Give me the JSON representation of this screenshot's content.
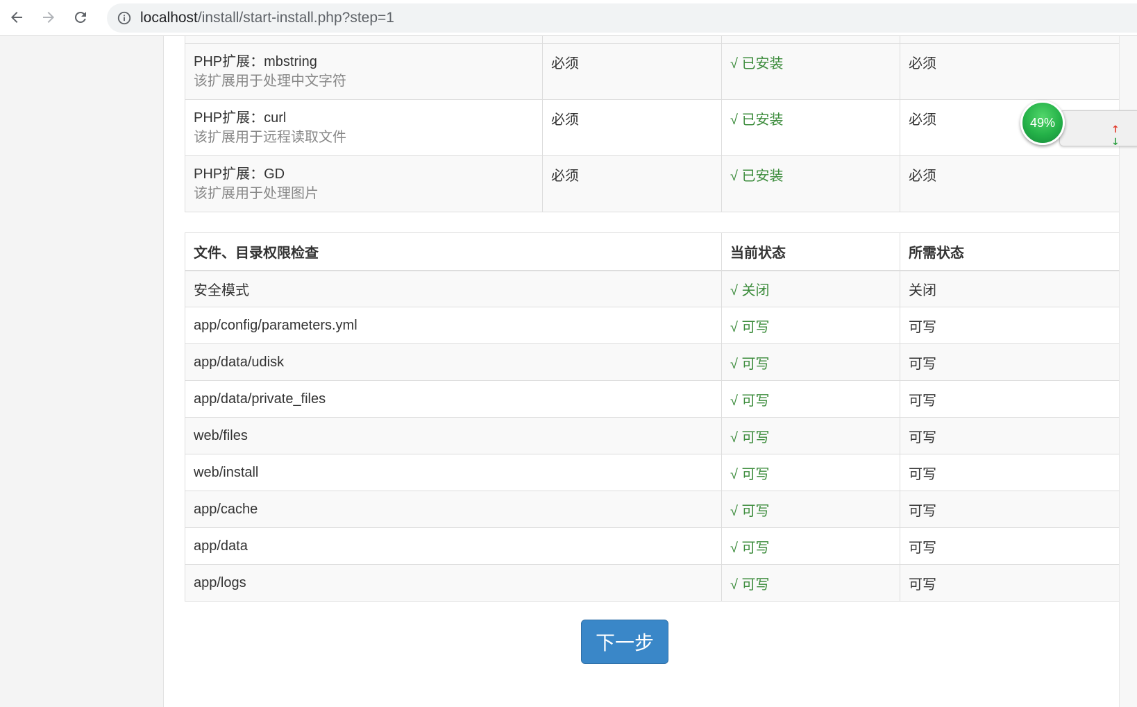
{
  "browser": {
    "url_host": "localhost",
    "url_path": "/install/start-install.php?step=1"
  },
  "extensions": [
    {
      "name": "PHP扩展：mbstring",
      "desc": "该扩展用于处理中文字符",
      "required": "必须",
      "status": "√ 已安装",
      "needed": "必须"
    },
    {
      "name": "PHP扩展：curl",
      "desc": "该扩展用于远程读取文件",
      "required": "必须",
      "status": "√ 已安装",
      "needed": "必须"
    },
    {
      "name": "PHP扩展：GD",
      "desc": "该扩展用于处理图片",
      "required": "必须",
      "status": "√ 已安装",
      "needed": "必须"
    }
  ],
  "permissions": {
    "headers": [
      "文件、目录权限检查",
      "当前状态",
      "所需状态"
    ],
    "rows": [
      {
        "item": "安全模式",
        "current": "√ 关闭",
        "needed": "关闭"
      },
      {
        "item": "app/config/parameters.yml",
        "current": "√ 可写",
        "needed": "可写"
      },
      {
        "item": "app/data/udisk",
        "current": "√ 可写",
        "needed": "可写"
      },
      {
        "item": "app/data/private_files",
        "current": "√ 可写",
        "needed": "可写"
      },
      {
        "item": "web/files",
        "current": "√ 可写",
        "needed": "可写"
      },
      {
        "item": "web/install",
        "current": "√ 可写",
        "needed": "可写"
      },
      {
        "item": "app/cache",
        "current": "√ 可写",
        "needed": "可写"
      },
      {
        "item": "app/data",
        "current": "√ 可写",
        "needed": "可写"
      },
      {
        "item": "app/logs",
        "current": "√ 可写",
        "needed": "可写"
      }
    ]
  },
  "next_button": "下一步",
  "speed_widget": {
    "percent": "49%"
  }
}
